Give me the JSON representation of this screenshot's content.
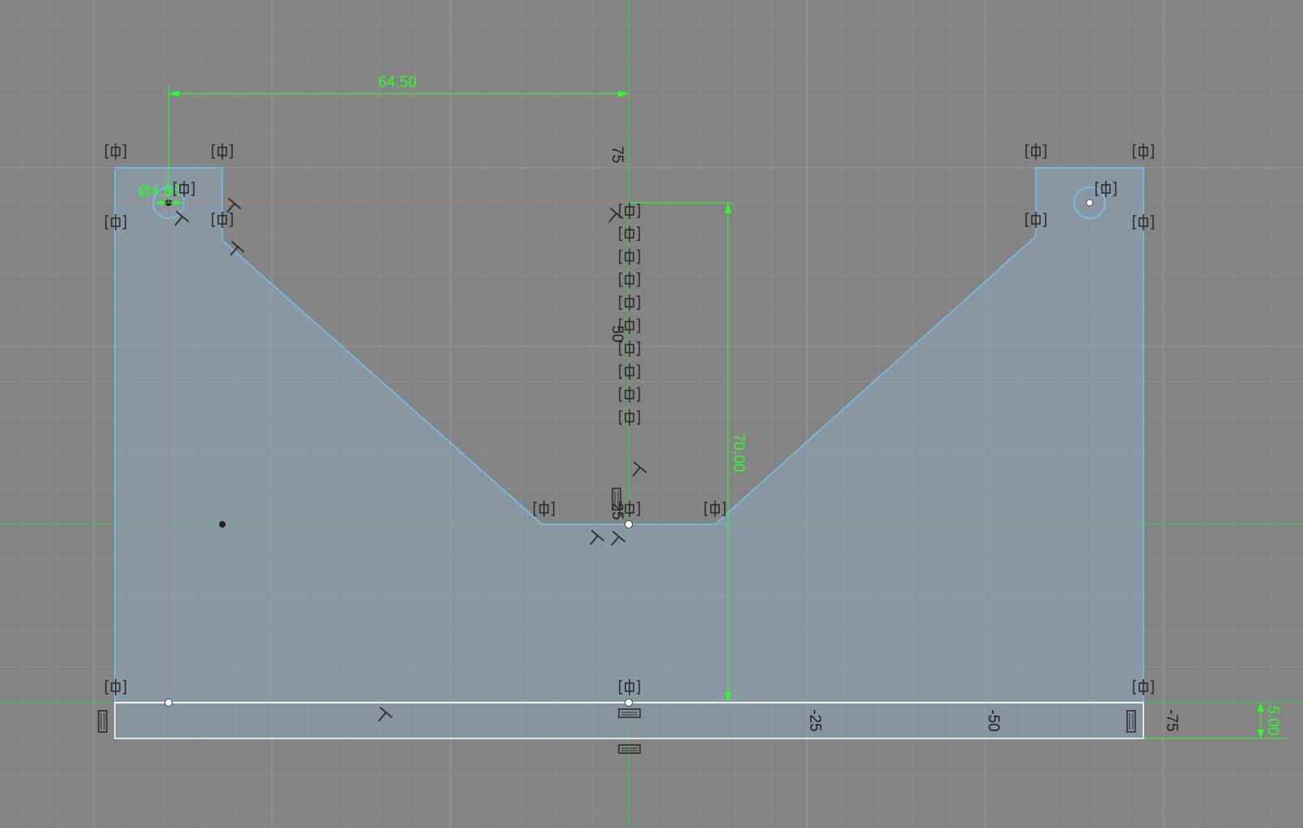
{
  "app": "Sketch canvas",
  "colors": {
    "background": "#848484",
    "grid_minor": "#8e8e8e",
    "grid_major": "#9a9a9a",
    "axis": "#36d13a",
    "profile_fill": "#8ea8bd",
    "profile_edge": "#6fc4f2",
    "dimension": "#2aff2a",
    "constraint_glyph": "#2d2d2d",
    "projected_line": "#b07a55"
  },
  "axis_labels": {
    "v75": "75",
    "v50": "50",
    "v25": "25",
    "h_neg25": "-25",
    "h_neg50": "-50",
    "h_neg75": "-75"
  },
  "dimensions": {
    "horizontal_offset": "64.50",
    "hole_diameter": "Ø4.50",
    "vertical_height": "70.00",
    "base_thickness": "5.00"
  },
  "icons": {
    "coincident": "coincident-constraint-icon",
    "horizontal": "horizontal-constraint-icon",
    "vertical": "vertical-constraint-icon",
    "perpendicular": "perpendicular-constraint-icon"
  }
}
